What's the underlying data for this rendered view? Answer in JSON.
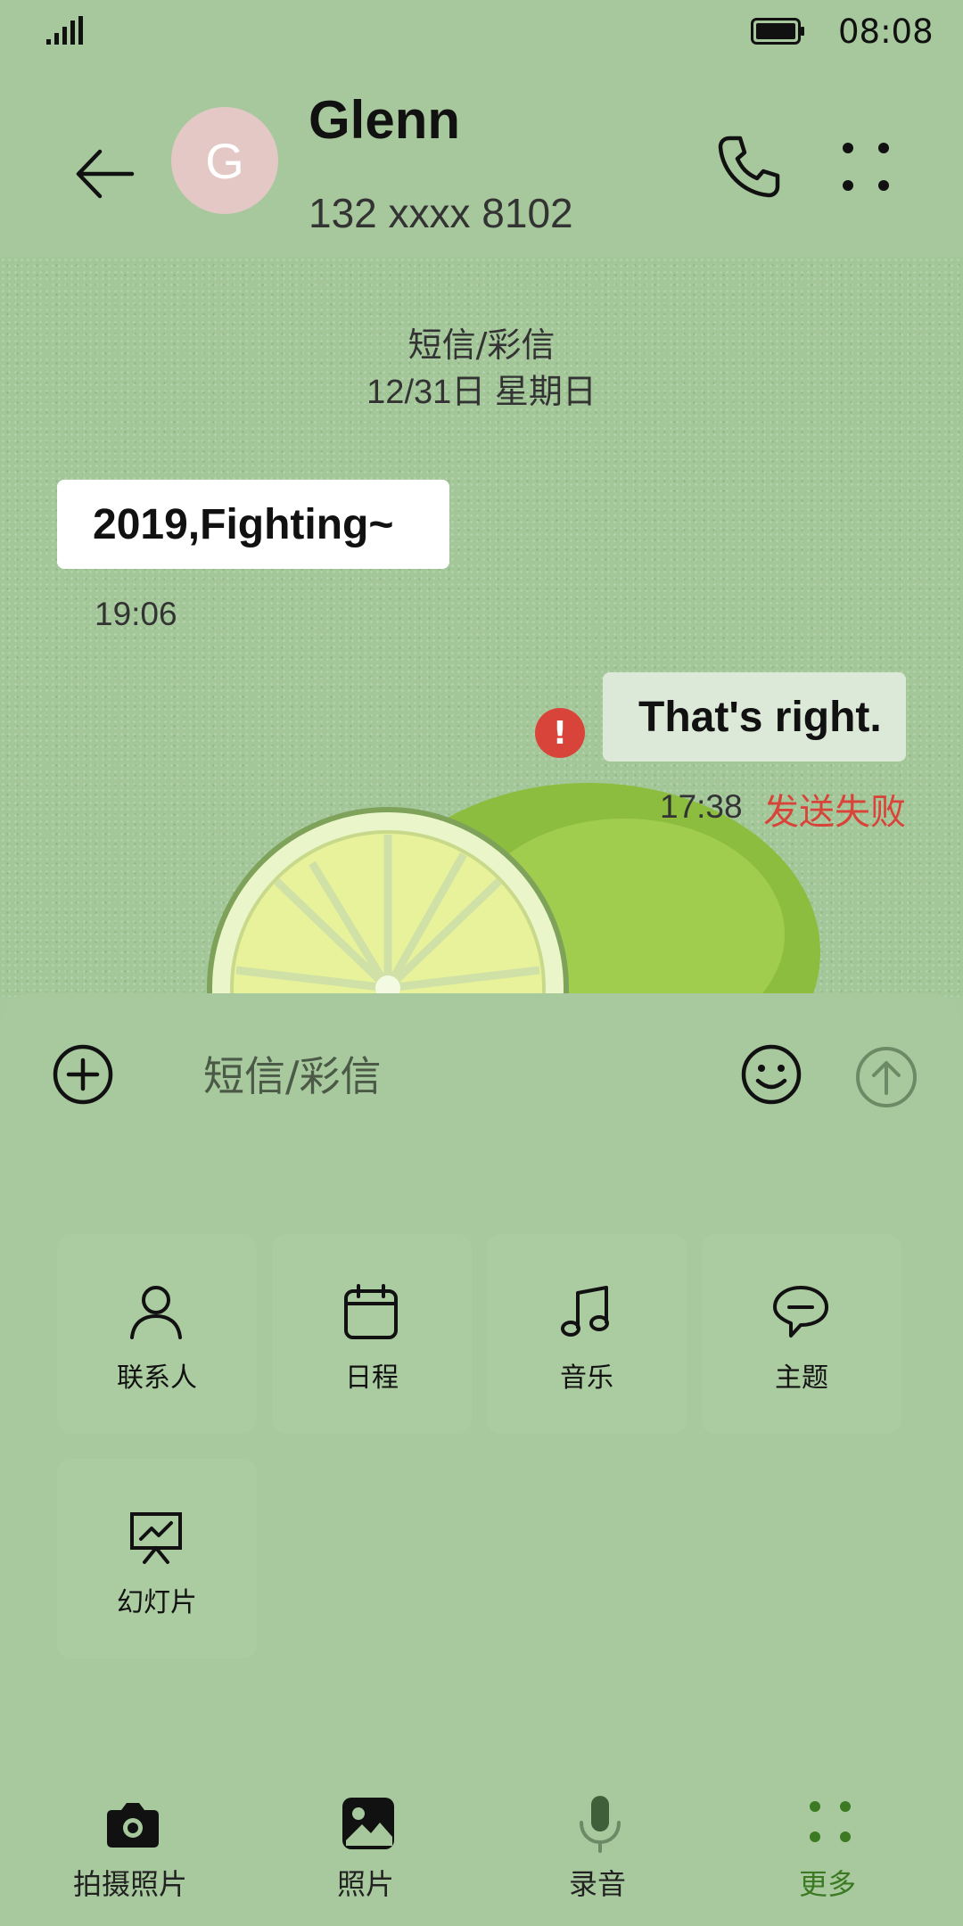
{
  "status_bar": {
    "time": "08:08"
  },
  "header": {
    "avatar_letter": "G",
    "contact_name": "Glenn",
    "contact_number": "132 xxxx 8102"
  },
  "chat": {
    "source_label": "短信/彩信",
    "date_label": "12/31日 星期日",
    "messages": [
      {
        "direction": "incoming",
        "text": "2019,Fighting~",
        "time": "19:06"
      },
      {
        "direction": "outgoing",
        "text": "That's right.",
        "time": "17:38",
        "status": "发送失败",
        "error_mark": "!"
      }
    ]
  },
  "composer": {
    "placeholder": "短信/彩信"
  },
  "attachments": [
    {
      "label": "联系人",
      "icon": "contact-icon"
    },
    {
      "label": "日程",
      "icon": "calendar-icon"
    },
    {
      "label": "音乐",
      "icon": "music-icon"
    },
    {
      "label": "主题",
      "icon": "theme-icon"
    },
    {
      "label": "幻灯片",
      "icon": "slideshow-icon"
    }
  ],
  "bottom_bar": [
    {
      "label": "拍摄照片",
      "icon": "camera-icon"
    },
    {
      "label": "照片",
      "icon": "photo-icon"
    },
    {
      "label": "录音",
      "icon": "microphone-icon"
    },
    {
      "label": "更多",
      "icon": "more-dots-icon",
      "active": true
    }
  ],
  "colors": {
    "background": "#a7c89d",
    "error_red": "#d9443a",
    "active_green": "#3b7a22",
    "avatar_bg": "#e3c8c6"
  }
}
